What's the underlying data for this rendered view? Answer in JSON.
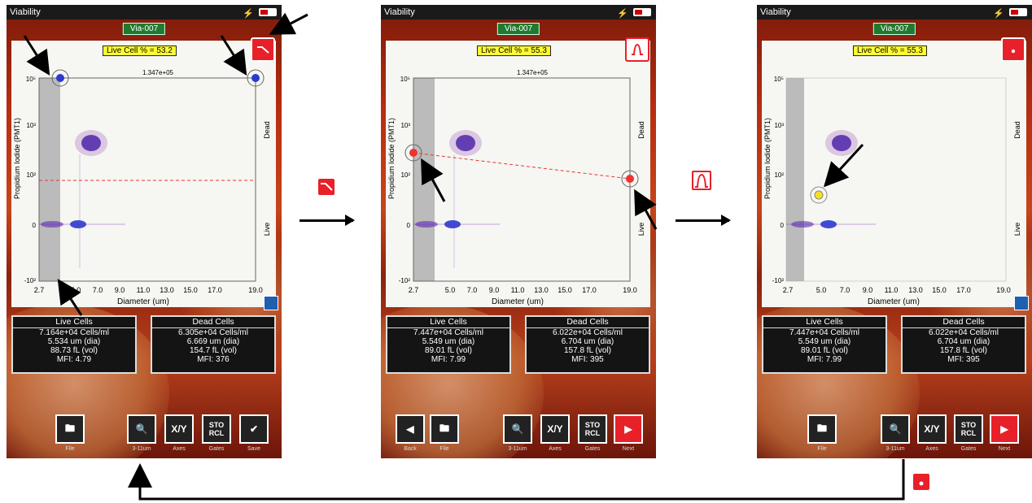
{
  "screens": [
    {
      "status_title": "Viability",
      "sample_id": "Via-007",
      "live_pct": "Live Cell % = 53.2",
      "top_value": "1.347e+05",
      "y_ticks": [
        "10⁵",
        "10³",
        "10²",
        "0",
        "-10²"
      ],
      "x_ticks": [
        "2.7",
        "5.0",
        "7.0",
        "9.0",
        "11.0",
        "13.0",
        "15.0",
        "17.0",
        "19.0"
      ],
      "x_label": "Diameter (um)",
      "y_label": "Propidium Iodide (PMT1)",
      "dead_label": "Dead",
      "live_label": "Live",
      "live": {
        "head": "Live Cells",
        "conc": "7.164e+04 Cells/ml",
        "dia": "5.534 um (dia)",
        "vol": "88.73 fL (vol)",
        "mfi": "MFI: 4.79"
      },
      "dead": {
        "head": "Dead Cells",
        "conc": "6.305e+04 Cells/ml",
        "dia": "6.669 um (dia)",
        "vol": "154.7 fL (vol)",
        "mfi": "MFI: 376"
      },
      "toolbar": [
        "File",
        "3-11um",
        "Axes",
        "Gates",
        "Save"
      ]
    },
    {
      "status_title": "Viability",
      "sample_id": "Via-007",
      "live_pct": "Live Cell % = 55.3",
      "top_value": "1.347e+05",
      "y_ticks": [
        "10⁵",
        "10³",
        "10²",
        "0",
        "-10²"
      ],
      "x_ticks": [
        "2.7",
        "5.0",
        "7.0",
        "9.0",
        "11.0",
        "13.0",
        "15.0",
        "17.0",
        "19.0"
      ],
      "x_label": "Diameter (um)",
      "y_label": "Propidium Iodide (PMT1)",
      "dead_label": "Dead",
      "live_label": "Live",
      "live": {
        "head": "Live Cells",
        "conc": "7.447e+04 Cells/ml",
        "dia": "5.549 um (dia)",
        "vol": "89.01 fL (vol)",
        "mfi": "MFI: 7.99"
      },
      "dead": {
        "head": "Dead Cells",
        "conc": "6.022e+04 Cells/ml",
        "dia": "6.704 um (dia)",
        "vol": "157.8 fL (vol)",
        "mfi": "MFI: 395"
      },
      "toolbar": [
        "Back",
        "File",
        "3-11um",
        "Axes",
        "Gates",
        "Next"
      ]
    },
    {
      "status_title": "Viability",
      "sample_id": "Via-007",
      "live_pct": "Live Cell % = 55.3",
      "y_ticks": [
        "10⁵",
        "10³",
        "10²",
        "0",
        "-10²"
      ],
      "x_ticks": [
        "2.7",
        "5.0",
        "7.0",
        "9.0",
        "11.0",
        "13.0",
        "15.0",
        "17.0",
        "19.0"
      ],
      "x_label": "Diameter (um)",
      "y_label": "Propidium Iodide (PMT1)",
      "dead_label": "Dead",
      "live_label": "Live",
      "live": {
        "head": "Live Cells",
        "conc": "7.447e+04 Cells/ml",
        "dia": "5.549 um (dia)",
        "vol": "89.01 fL (vol)",
        "mfi": "MFI: 7.99"
      },
      "dead": {
        "head": "Dead Cells",
        "conc": "6.022e+04 Cells/ml",
        "dia": "6.704 um (dia)",
        "vol": "157.8 fL (vol)",
        "mfi": "MFI: 395"
      },
      "toolbar": [
        "File",
        "3-11um",
        "Axes",
        "Gates",
        "Next"
      ]
    }
  ],
  "toolbar_icons": {
    "axes": "X/Y",
    "gates_top": "STO",
    "gates_bottom": "RCL"
  },
  "colors": {
    "accent_red": "#e8202a",
    "sample_green": "#1f7a2e",
    "live_pct_yellow": "#ffff30",
    "axis_blue": "#1e5fb0"
  }
}
